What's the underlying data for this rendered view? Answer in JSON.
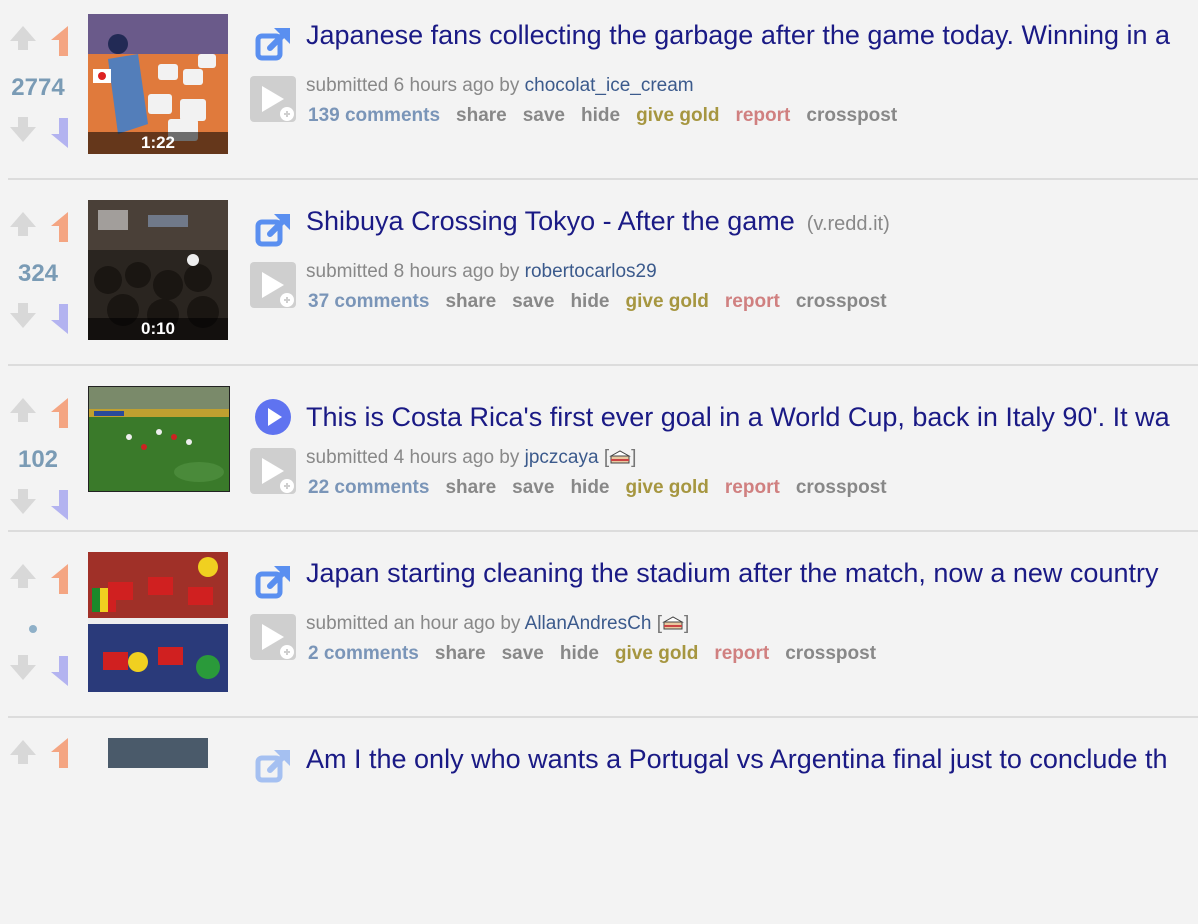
{
  "posts": [
    {
      "score": "2774",
      "thumb_time": "1:22",
      "title": "Japanese fans collecting the garbage after the game today. Winning in a",
      "domain": "",
      "submitted": "submitted 6 hours ago by",
      "author": "chocolat_ice_cream",
      "flair": "",
      "comments": "139 comments",
      "icon": "external-link-icon"
    },
    {
      "score": "324",
      "thumb_time": "0:10",
      "title": "Shibuya Crossing Tokyo - After the game",
      "domain": "(v.redd.it)",
      "submitted": "submitted 8 hours ago by",
      "author": "robertocarlos29",
      "flair": "",
      "comments": "37 comments",
      "icon": "external-link-icon"
    },
    {
      "score": "102",
      "thumb_time": "",
      "title": "This is Costa Rica's first ever goal in a World Cup, back in Italy 90'. It wa",
      "domain": "",
      "submitted": "submitted 4 hours ago by",
      "author": "jpczcaya",
      "flair": "cake",
      "comments": "22 comments",
      "icon": "play-circle-icon"
    },
    {
      "score": "•",
      "thumb_time": "",
      "title": "Japan starting cleaning the stadium after the match, now a new country",
      "domain": "",
      "submitted": "submitted an hour ago by",
      "author": "AllanAndresCh",
      "flair": "cake",
      "comments": "2 comments",
      "icon": "external-link-icon"
    },
    {
      "score": "",
      "title": "Am I the only who wants a Portugal vs Argentina final just to conclude th",
      "icon": "external-link-icon"
    }
  ],
  "buttons": {
    "share": "share",
    "save": "save",
    "hide": "hide",
    "gold": "give gold",
    "report": "report",
    "crosspost": "crosspost"
  },
  "colors": {
    "title": "#1a1a85",
    "score": "#7a9bb5",
    "gold": "#a69640",
    "report": "#d08080",
    "upvote_flag": "#f4a582",
    "downvote_flag": "#b3b3f0"
  }
}
